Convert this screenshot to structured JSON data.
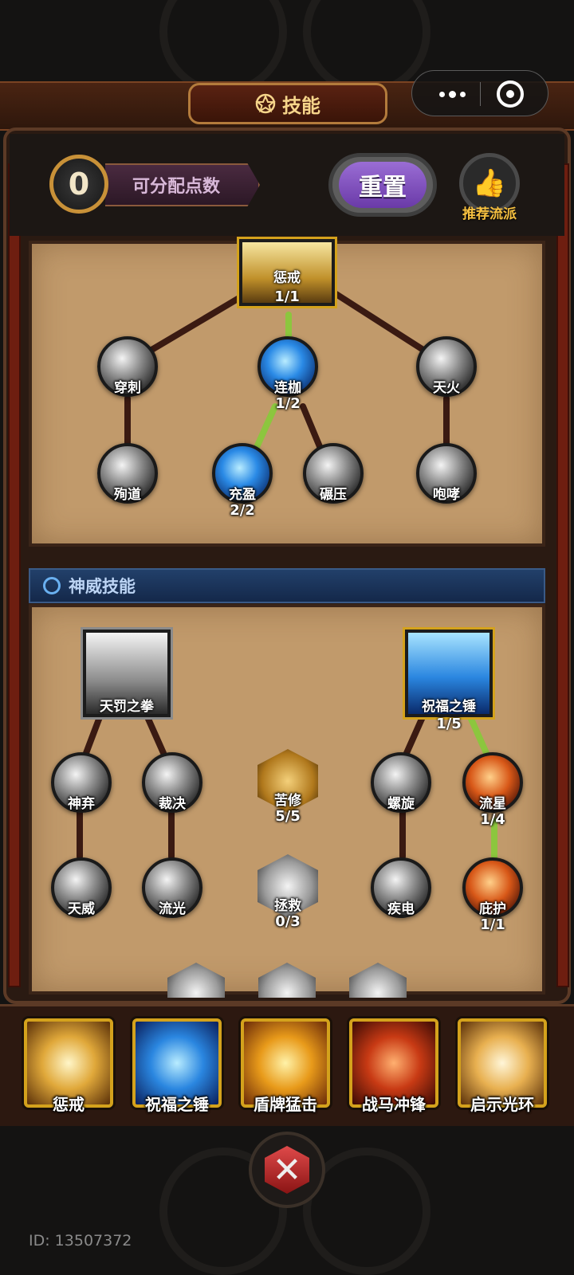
{
  "header": {
    "title": "技能",
    "title_icon": "pentagram-icon",
    "capsule": {
      "more_icon": "more-dots-icon",
      "close_icon": "target-icon"
    }
  },
  "points": {
    "value": "0",
    "label": "可分配点数"
  },
  "reset_label": "重置",
  "recommend_label": "推荐流派",
  "upper_tree": {
    "nodes": [
      {
        "id": "chengjie",
        "name": "惩戒",
        "level": "1/1"
      },
      {
        "id": "chuanci",
        "name": "穿刺",
        "level": ""
      },
      {
        "id": "lianjia",
        "name": "连枷",
        "level": "1/2"
      },
      {
        "id": "tianhuo",
        "name": "天火",
        "level": ""
      },
      {
        "id": "xundao",
        "name": "殉道",
        "level": ""
      },
      {
        "id": "chongying",
        "name": "充盈",
        "level": "2/2"
      },
      {
        "id": "nianya",
        "name": "碾压",
        "level": ""
      },
      {
        "id": "paoxiao",
        "name": "咆哮",
        "level": ""
      }
    ]
  },
  "section": {
    "title": "神威技能",
    "icon": "spiral-icon"
  },
  "lower_tree": {
    "nodes": [
      {
        "id": "tianfa",
        "name": "天罚之拳",
        "level": ""
      },
      {
        "id": "zhufu",
        "name": "祝福之锤",
        "level": "1/5"
      },
      {
        "id": "shenqi",
        "name": "神弃",
        "level": ""
      },
      {
        "id": "caijue",
        "name": "裁决",
        "level": ""
      },
      {
        "id": "kuxiu",
        "name": "苦修",
        "level": "5/5"
      },
      {
        "id": "luoxuan",
        "name": "螺旋",
        "level": ""
      },
      {
        "id": "liuxing",
        "name": "流星",
        "level": "1/4"
      },
      {
        "id": "tianwei",
        "name": "天威",
        "level": ""
      },
      {
        "id": "liuguang",
        "name": "流光",
        "level": ""
      },
      {
        "id": "zhengjiu",
        "name": "拯救",
        "level": "0/3"
      },
      {
        "id": "jidian",
        "name": "疾电",
        "level": ""
      },
      {
        "id": "bihu",
        "name": "庇护",
        "level": "1/1"
      }
    ]
  },
  "bottom_slots": [
    {
      "name": "惩戒",
      "icon": "holy-cross-icon"
    },
    {
      "name": "祝福之锤",
      "icon": "hammer-icon"
    },
    {
      "name": "盾牌猛击",
      "icon": "shield-icon"
    },
    {
      "name": "战马冲锋",
      "icon": "warhorse-icon"
    },
    {
      "name": "启示光环",
      "icon": "light-aura-icon"
    }
  ],
  "battle_icon": "crossed-swords-icon",
  "user_id": "ID: 13507372",
  "colors": {
    "accent_gold": "#d4a21c",
    "active_line": "#8cc63e",
    "inactive_line": "#3a1a12",
    "purple_button": "#7a48bc"
  }
}
